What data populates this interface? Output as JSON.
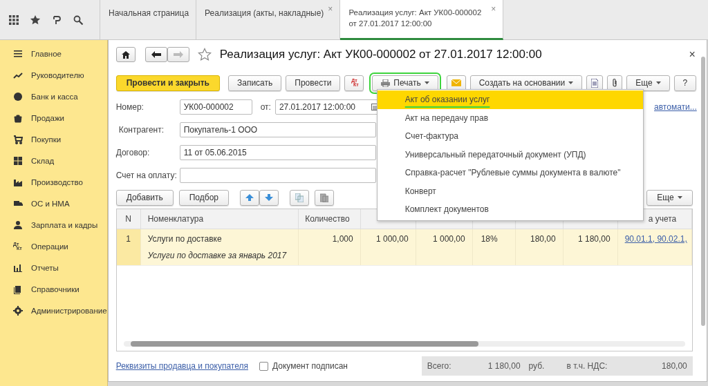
{
  "tabs": [
    {
      "label": "Начальная страница",
      "selected": false
    },
    {
      "label": "Реализация (акты, накладные)",
      "selected": false,
      "close": "×"
    },
    {
      "label": "Реализация услуг: Акт УК00-000002 от 27.01.2017 12:00:00",
      "selected": true,
      "close": "×"
    }
  ],
  "sidebar": {
    "items": [
      {
        "label": "Главное"
      },
      {
        "label": "Руководителю"
      },
      {
        "label": "Банк и касса"
      },
      {
        "label": "Продажи"
      },
      {
        "label": "Покупки"
      },
      {
        "label": "Склад"
      },
      {
        "label": "Производство"
      },
      {
        "label": "ОС и НМА"
      },
      {
        "label": "Зарплата и кадры"
      },
      {
        "label": "Операции",
        "icon_text": [
          "Дт",
          "Кт"
        ]
      },
      {
        "label": "Отчеты"
      },
      {
        "label": "Справочники"
      },
      {
        "label": "Администрирование"
      }
    ]
  },
  "form": {
    "title": "Реализация услуг: Акт УК00-000002 от 27.01.2017 12:00:00",
    "close": "×",
    "toolbar": [
      {
        "kind": "primary",
        "label": "Провести и закрыть"
      },
      {
        "kind": "plain",
        "label": "Записать"
      },
      {
        "kind": "plain",
        "label": "Провести"
      },
      {
        "kind": "dtkt",
        "icon_text": [
          "Дт",
          "Кт"
        ]
      },
      {
        "kind": "menu",
        "label": "Печать",
        "highlighted": true
      },
      {
        "kind": "mail"
      },
      {
        "kind": "menu",
        "label": "Создать на основании",
        "highlighted": false
      },
      {
        "kind": "doc"
      },
      {
        "kind": "clip"
      },
      {
        "kind": "menu",
        "label": "Еще",
        "highlighted": false
      },
      {
        "kind": "plain",
        "label": "?"
      }
    ],
    "number": {
      "label": "Номер:",
      "value": "УК00-000002",
      "date_label": "от:",
      "date": "27.01.2017 12:00:00",
      "link": "автомати..."
    },
    "fields": [
      {
        "label": "Контрагент:",
        "value": "Покупатель-1 ООО"
      },
      {
        "label": "Договор:",
        "value": "11 от 05.06.2015"
      },
      {
        "label": "Счет на оплату:"
      }
    ],
    "table_toolbar": {
      "buttons": [
        "Добавить",
        "Подбор"
      ],
      "more": "Еще"
    },
    "print_menu": {
      "items": [
        {
          "label": "Акт об оказании услуг",
          "selected": true
        },
        {
          "label": "Акт на передачу прав",
          "selected": false
        },
        {
          "label": "Счет-фактура",
          "selected": false
        },
        {
          "label": "Универсальный передаточный документ (УПД)",
          "selected": false
        },
        {
          "label": "Справка-расчет \"Рублевые суммы документа в валюте\"",
          "selected": false
        },
        {
          "label": "Конверт",
          "selected": false
        },
        {
          "label": "Комплект документов",
          "selected": false
        }
      ]
    },
    "table": {
      "columns": [
        "N",
        "Номенклатура",
        "Количество",
        "",
        "",
        "",
        "",
        "",
        "а учета"
      ],
      "rows": [
        {
          "selected": true,
          "cells": [
            "1",
            "Услуги по доставке",
            "1,000",
            "1 000,00",
            "1 000,00",
            "18%",
            "180,00",
            "1 180,00",
            "90.01.1, 90.02.1,"
          ],
          "comment": "Услуги по доставке за январь 2017"
        }
      ]
    },
    "footer": {
      "link": "Реквизиты продавца и покупателя",
      "signed": {
        "label": "Документ подписан",
        "checked": false
      },
      "total_label": "Всего:",
      "total": "1 180,00",
      "currency": "руб.",
      "vat_label": "в т.ч. НДС:",
      "vat": "180,00"
    }
  }
}
